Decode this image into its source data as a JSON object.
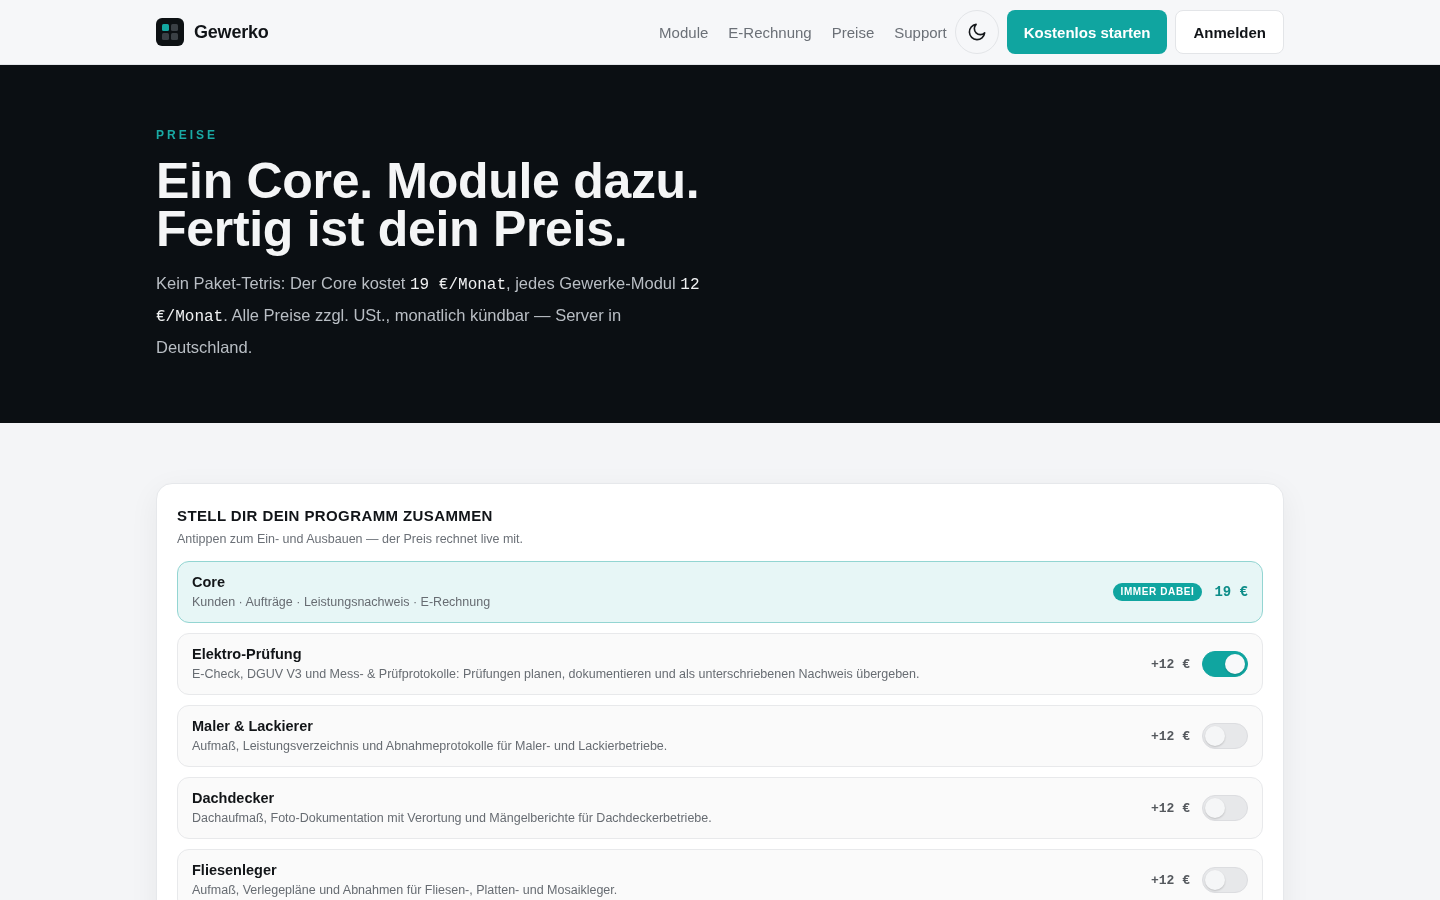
{
  "header": {
    "brand": "Gewerko",
    "nav": [
      "Module",
      "E-Rechnung",
      "Preise",
      "Support"
    ],
    "cta": "Kostenlos starten",
    "login": "Anmelden"
  },
  "hero": {
    "eyebrow": "PREISE",
    "title_lines": [
      "Ein Core. Module dazu.",
      "Fertig ist dein Preis."
    ],
    "intro": [
      {
        "kind": "text",
        "text": "Kein Paket-Tetris: Der Core kostet "
      },
      {
        "kind": "mono",
        "text": "19 €/Monat"
      },
      {
        "kind": "text",
        "text": ", jedes Gewerke-Modul "
      },
      {
        "kind": "mono",
        "text": "12 €/Monat"
      },
      {
        "kind": "text",
        "text": ". Alle Preise zzgl. USt., monatlich kündbar — Server in Deutschland."
      }
    ]
  },
  "configurator": {
    "title": "STELL DIR DEIN PROGRAMM ZUSAMMEN",
    "subtitle": "Antippen zum Ein- und Ausbauen — der Preis rechnet live mit.",
    "modules": [
      {
        "kind": "core",
        "name": "Core",
        "description": "Kunden · Aufträge · Leistungsnachweis · E-Rechnung",
        "badge": "IMMER DABEI",
        "price": "19 €"
      },
      {
        "kind": "addon",
        "name": "Elektro-Prüfung",
        "description": "E-Check, DGUV V3 und Mess- & Prüfprotokolle: Prüfungen planen, dokumentieren und als unterschriebenen Nachweis übergeben.",
        "price": "+12 €",
        "on": true
      },
      {
        "kind": "addon",
        "name": "Maler & Lackierer",
        "description": "Aufmaß, Leistungsverzeichnis und Abnahmeprotokolle für Maler- und Lackierbetriebe.",
        "price": "+12 €",
        "on": false
      },
      {
        "kind": "addon",
        "name": "Dachdecker",
        "description": "Dachaufmaß, Foto-Dokumentation mit Verortung und Mängelberichte für Dachdeckerbetriebe.",
        "price": "+12 €",
        "on": false
      },
      {
        "kind": "addon",
        "name": "Fliesenleger",
        "description": "Aufmaß, Verlegepläne und Abnahmen für Fliesen-, Platten- und Mosaikleger.",
        "price": "+12 €",
        "on": false
      }
    ]
  }
}
